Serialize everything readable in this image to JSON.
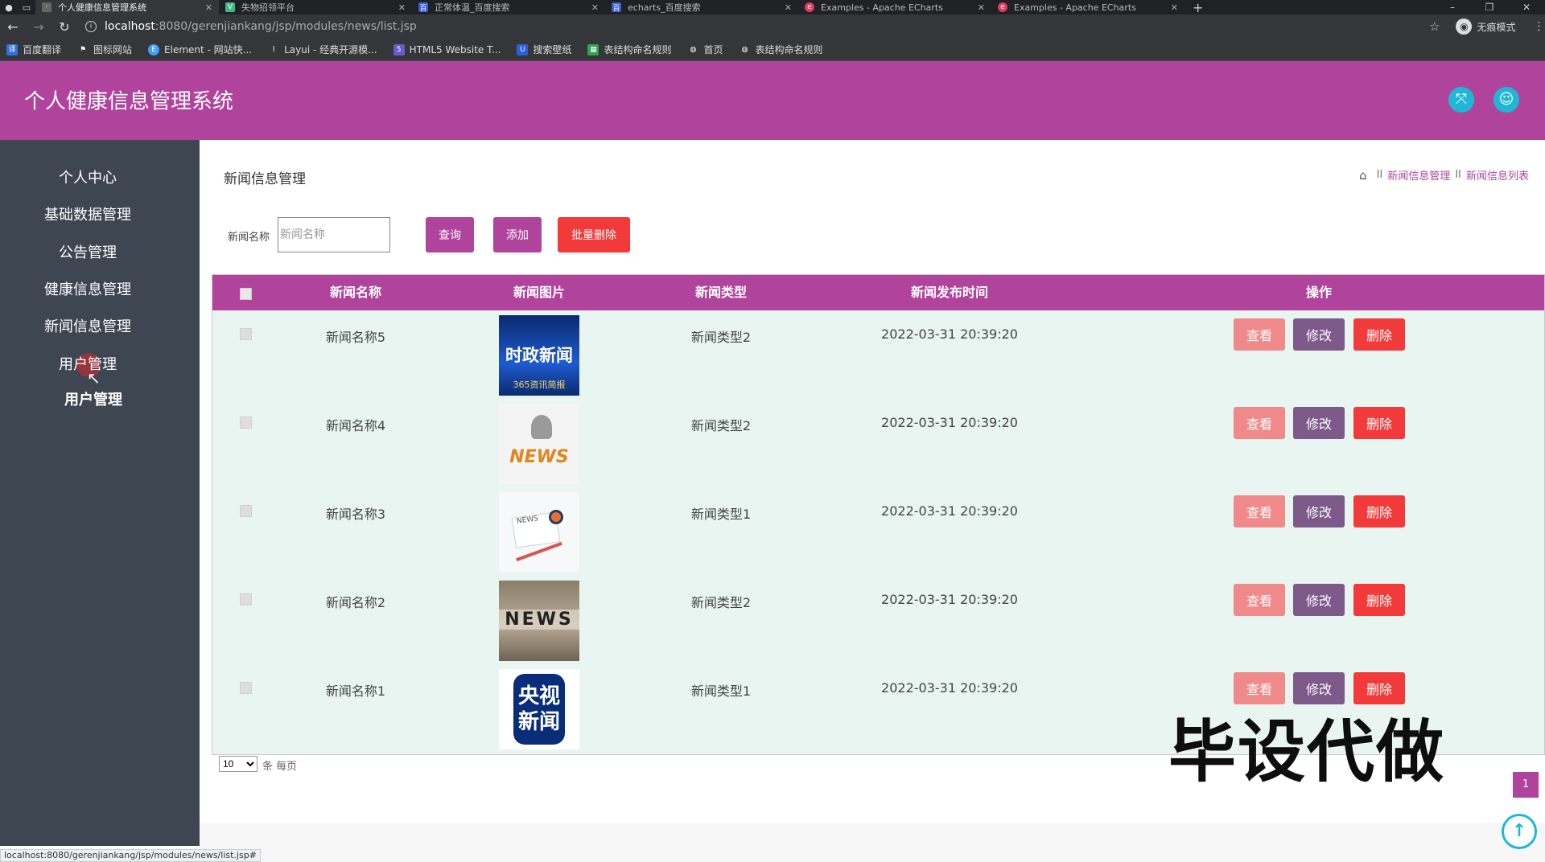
{
  "browser": {
    "tabs": [
      {
        "label": "个人健康信息管理系统",
        "active": true
      },
      {
        "label": "失物招领平台",
        "active": false
      },
      {
        "label": "正常体温_百度搜索",
        "active": false
      },
      {
        "label": "echarts_百度搜索",
        "active": false
      },
      {
        "label": "Examples - Apache ECharts",
        "active": false
      },
      {
        "label": "Examples - Apache ECharts",
        "active": false
      }
    ],
    "url_host": "localhost",
    "url_rest": ":8080/gerenjiankang/jsp/modules/news/list.jsp",
    "incognito_label": "无痕模式",
    "bookmarks": [
      "百度翻译",
      "图标网站",
      "Element - 网站快...",
      "Layui - 经典开源模...",
      "HTML5 Website T...",
      "搜索壁纸",
      "表结构命名规则",
      "首页",
      "表结构命名规则"
    ]
  },
  "header": {
    "title": "个人健康信息管理系统"
  },
  "sidebar": {
    "items": [
      "个人中心",
      "基础数据管理",
      "公告管理",
      "健康信息管理",
      "新闻信息管理",
      "用户管理"
    ],
    "subitems": [
      "用户管理"
    ]
  },
  "main": {
    "page_title": "新闻信息管理",
    "breadcrumb": [
      "新闻信息管理",
      "新闻信息列表"
    ],
    "search": {
      "label": "新闻名称",
      "placeholder": "新闻名称",
      "value": ""
    },
    "buttons": {
      "query": "查询",
      "add": "添加",
      "batch_delete": "批量删除"
    }
  },
  "table": {
    "columns": [
      "新闻名称",
      "新闻图片",
      "新闻类型",
      "新闻发布时间",
      "操作"
    ],
    "rows": [
      {
        "name": "新闻名称5",
        "type": "新闻类型2",
        "time": "2022-03-31 20:39:20",
        "image_text": "时政新闻",
        "image_sub": "365资讯简报"
      },
      {
        "name": "新闻名称4",
        "type": "新闻类型2",
        "time": "2022-03-31 20:39:20",
        "image_text": "NEWS",
        "image_sub": ""
      },
      {
        "name": "新闻名称3",
        "type": "新闻类型1",
        "time": "2022-03-31 20:39:20",
        "image_text": "NEWS",
        "image_sub": ""
      },
      {
        "name": "新闻名称2",
        "type": "新闻类型2",
        "time": "2022-03-31 20:39:20",
        "image_text": "NEWS",
        "image_sub": ""
      },
      {
        "name": "新闻名称1",
        "type": "新闻类型1",
        "time": "2022-03-31 20:39:20",
        "image_text": "央视新闻",
        "image_sub": ""
      }
    ],
    "actions": {
      "view": "查看",
      "edit": "修改",
      "delete": "删除"
    }
  },
  "pager": {
    "page_size": "10",
    "page_size_label": "条 每页",
    "current_page": "1"
  },
  "watermark": "毕设代做",
  "status_url": "localhost:8080/gerenjiankang/jsp/modules/news/list.jsp#",
  "colors": {
    "primary": "#b0449c",
    "sidebar": "#3e4652",
    "view": "#f08a8a",
    "edit": "#7d5a8a",
    "delete": "#f23a3a",
    "row_bg": "#e8f5f1",
    "accent": "#1fb7d6"
  }
}
